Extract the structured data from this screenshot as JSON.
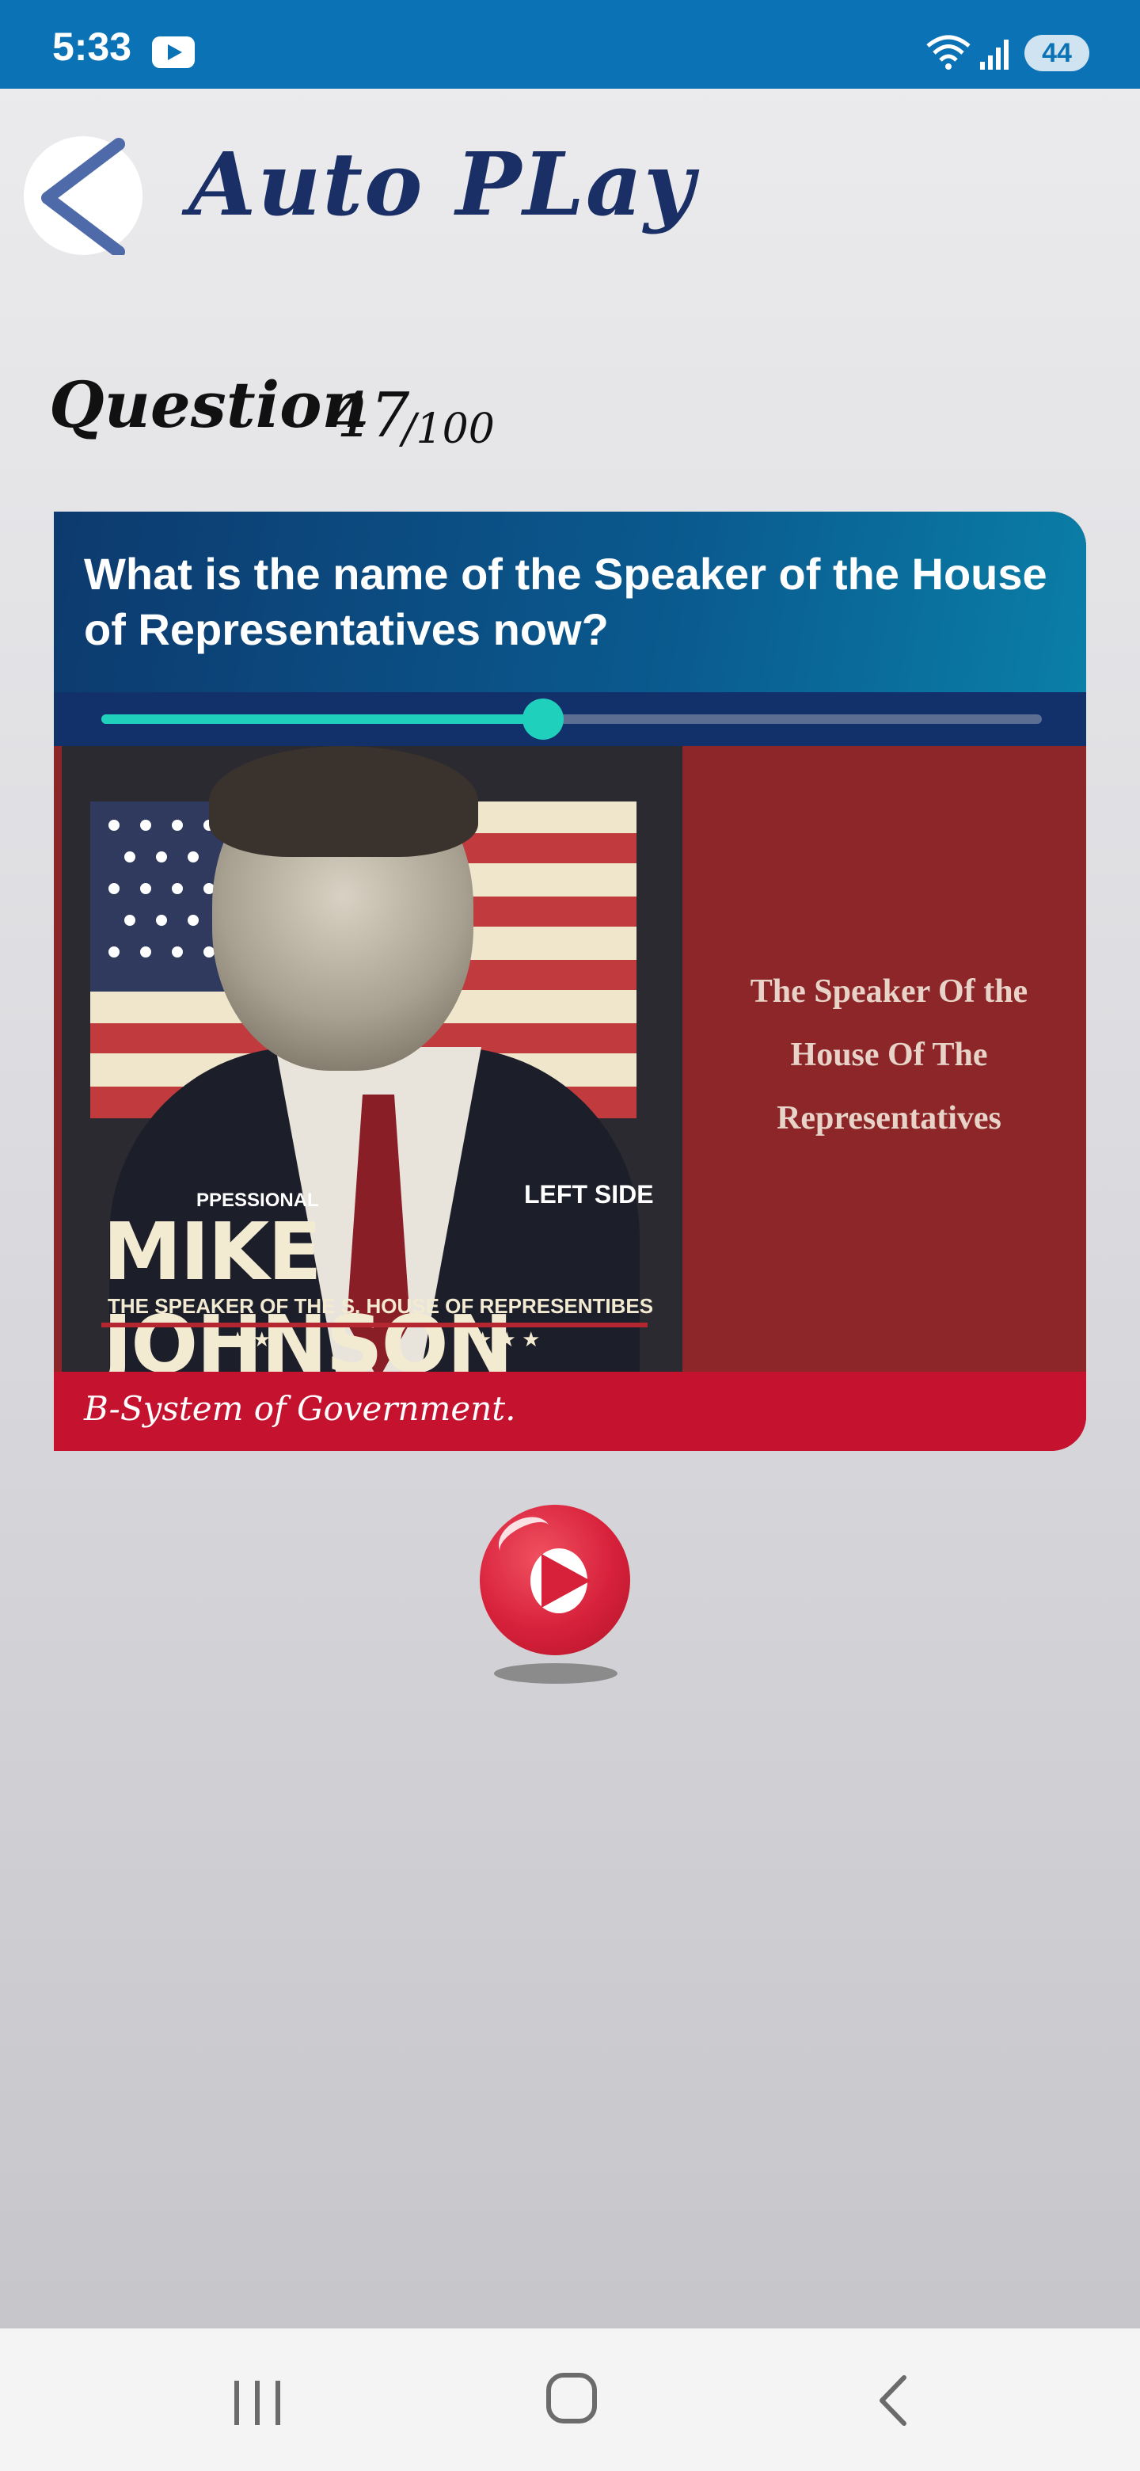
{
  "status_bar": {
    "time": "5:33",
    "battery": "44"
  },
  "header": {
    "title": "Auto PLay"
  },
  "question": {
    "label": "Question",
    "number": "47",
    "total": "/100"
  },
  "card": {
    "question_text": "What is the name of the Speaker of the House of Representatives now?",
    "progress_fraction": 0.47,
    "poster": {
      "small_text": "PPESSIONAL",
      "left_side": "LEFT SIDE",
      "name": "MIKE JOHNSON",
      "subtitle": "THE SPEAKER OF THE S. HOUSE OF REPRESENTIBES"
    },
    "image_caption": "The Speaker Of the House Of The Representatives",
    "category": "B-System of Government."
  },
  "icons": {
    "back": "chevron-left-icon",
    "play": "play-icon",
    "nav_recents": "recents-icon",
    "nav_home": "home-icon",
    "nav_back": "back-icon"
  },
  "colors": {
    "status_bar": "#0b72b5",
    "title": "#1a2f66",
    "slider": "#1fd0bd",
    "card_footer": "#c5132f",
    "play_button": "#d7213b"
  }
}
